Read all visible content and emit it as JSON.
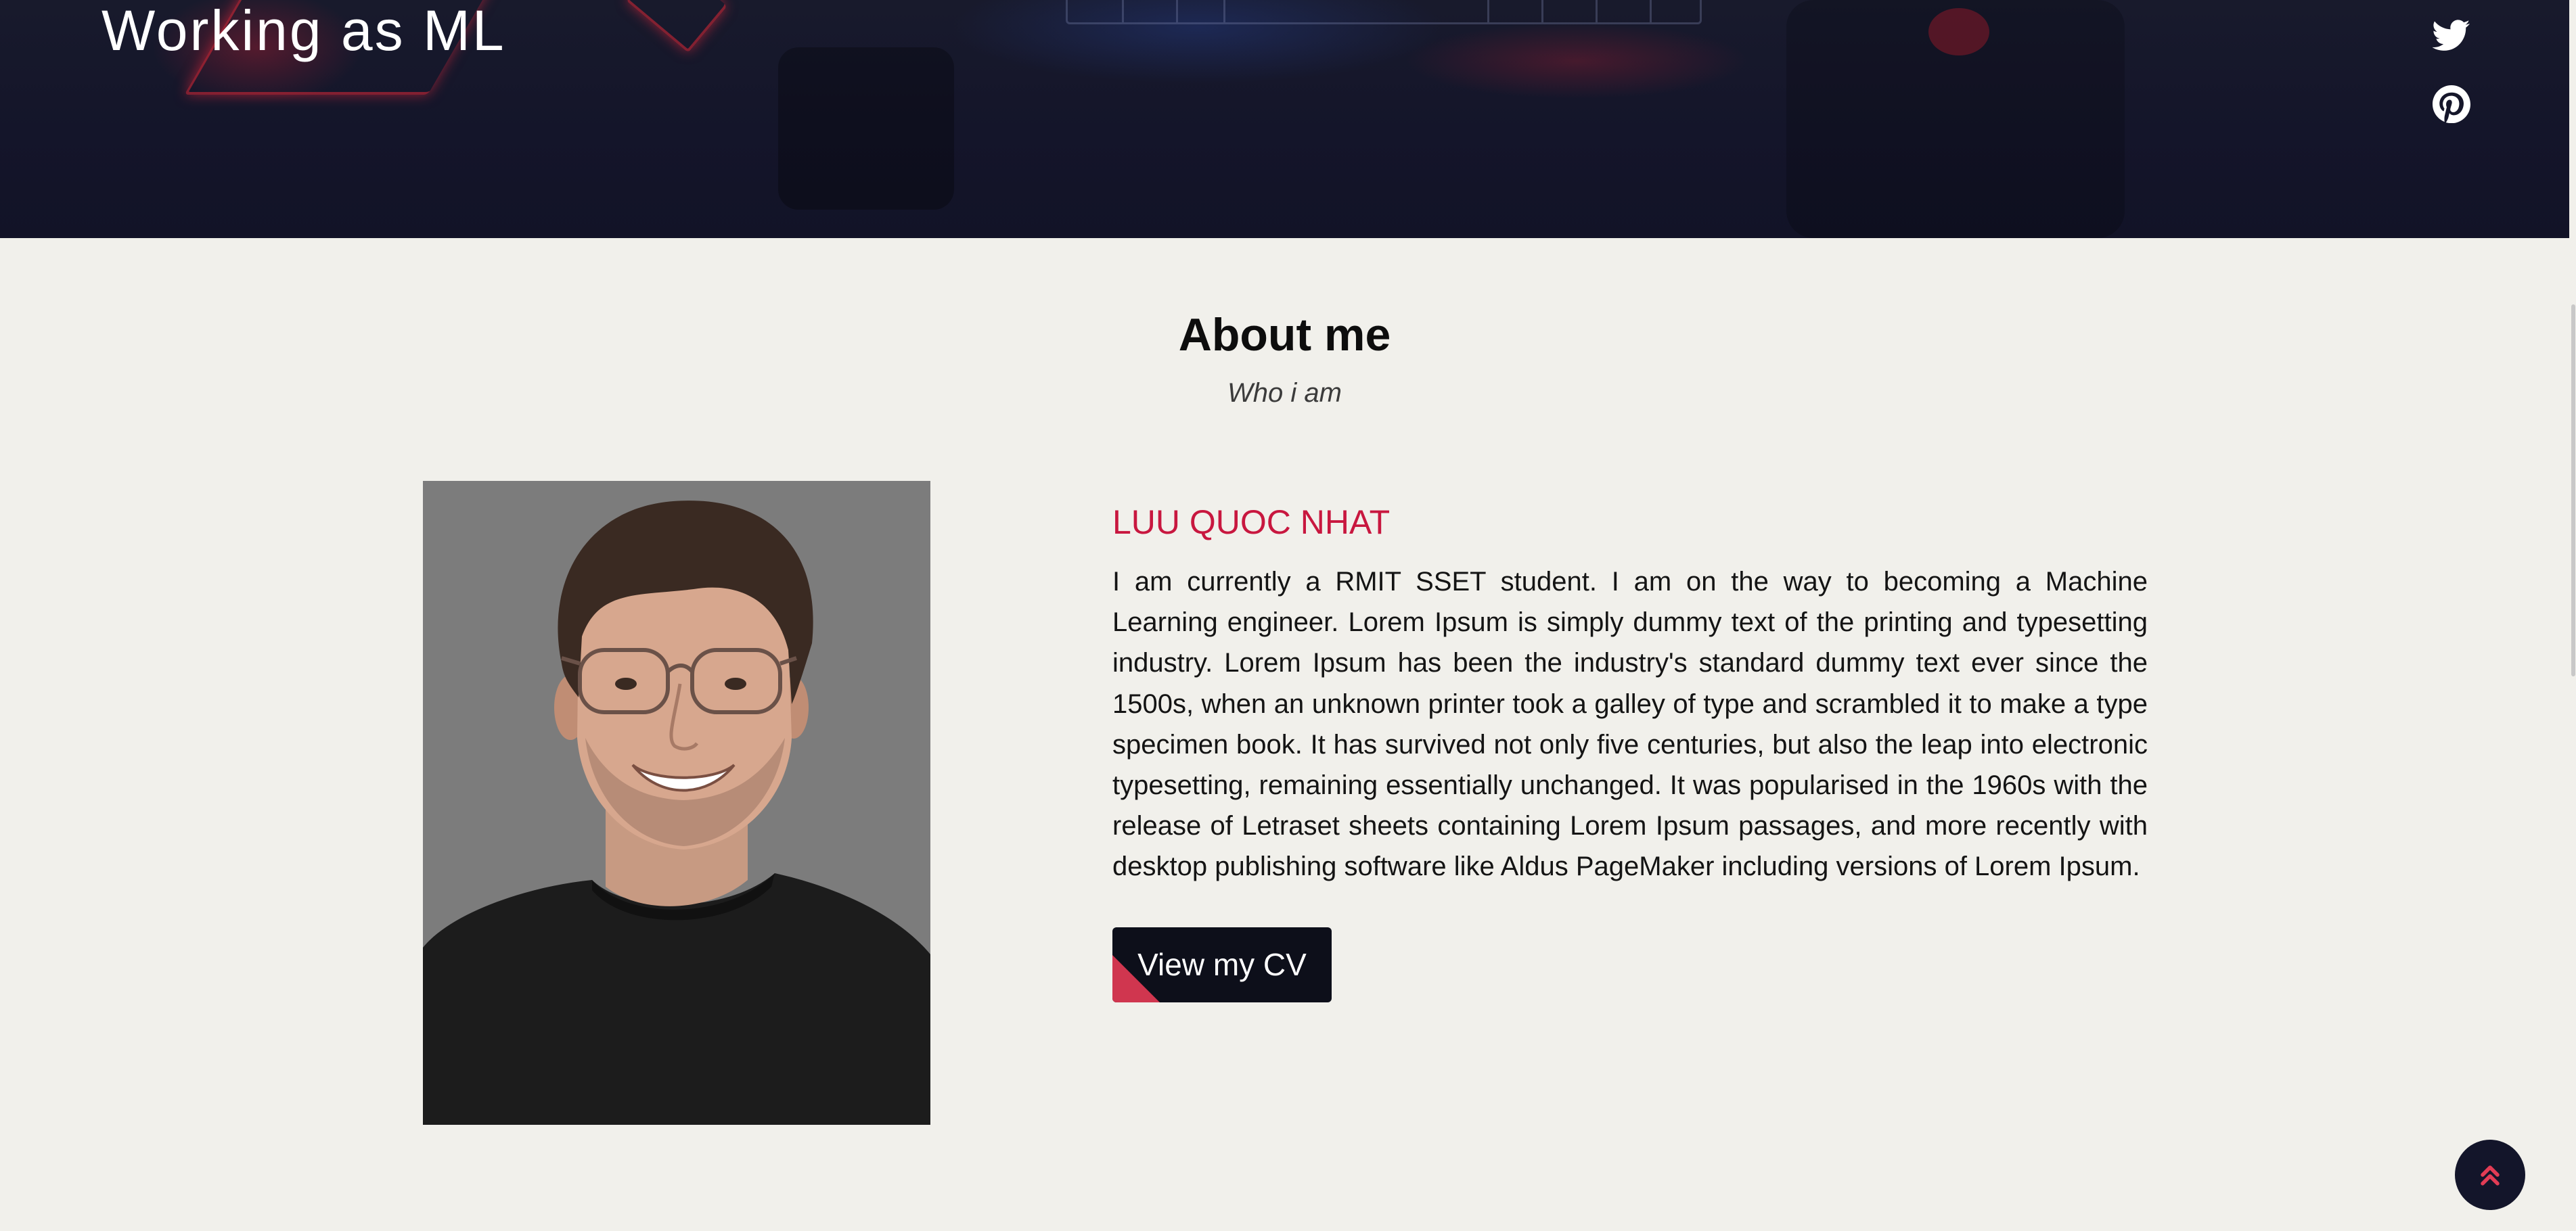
{
  "hero": {
    "title": "Working as ML",
    "social_links": [
      {
        "icon": "twitter-icon",
        "label": "Twitter"
      },
      {
        "icon": "pinterest-icon",
        "label": "Pinterest"
      }
    ]
  },
  "about": {
    "heading": "About me",
    "subheading": "Who i am",
    "photo_icon": "profile-photo",
    "name": "LUU QUOC NHAT",
    "bio": "I am currently a RMIT SSET student. I am on the way to becoming a Machine Learning engineer. Lorem Ipsum is simply dummy text of the printing and typesetting industry. Lorem Ipsum has been the industry's standard dummy text ever since the 1500s, when an unknown printer took a galley of type and scrambled it to make a type specimen book. It has survived not only five centuries, but also the leap into electronic typesetting, remaining essentially unchanged. It was popularised in the 1960s with the release of Letraset sheets containing Lorem Ipsum passages, and more recently with desktop publishing software like Aldus PageMaker including versions of Lorem Ipsum.",
    "cv_button_label": "View my CV"
  },
  "back_to_top": {
    "icon": "double-chevron-up-icon"
  },
  "colors": {
    "hero_background": "#14152a",
    "page_background": "#f1f0eb",
    "accent_name": "#c8173f",
    "button_background": "#0d0f1a",
    "button_accent": "#d0364f",
    "back_to_top_arrow": "#e23c55"
  }
}
